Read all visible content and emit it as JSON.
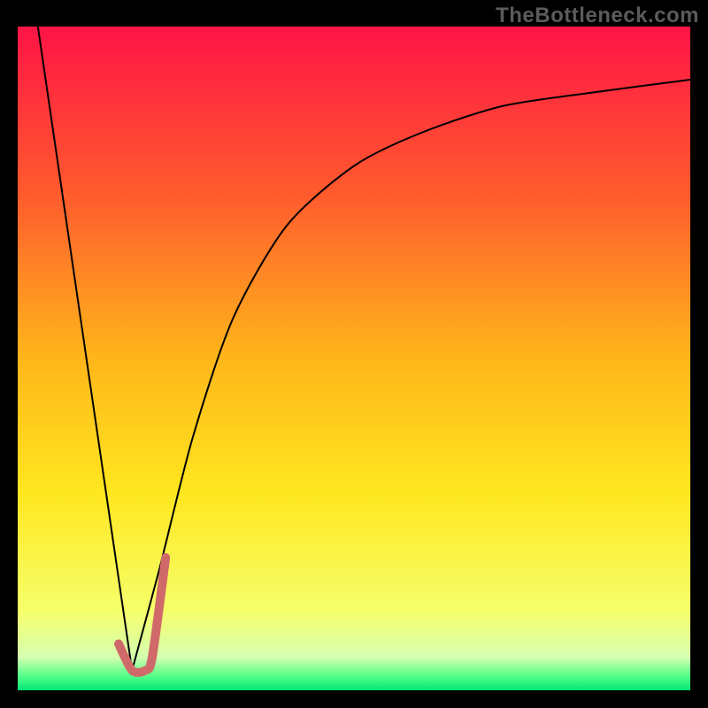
{
  "watermark": "TheBottleneck.com",
  "chart_data": {
    "type": "line",
    "title": "",
    "xlabel": "",
    "ylabel": "",
    "xlim": [
      0,
      100
    ],
    "ylim": [
      0,
      100
    ],
    "grid": false,
    "legend": false,
    "series": [
      {
        "name": "left-descent",
        "color": "#000000",
        "width": 2,
        "values": [
          {
            "x": 3,
            "y": 100
          },
          {
            "x": 17,
            "y": 3
          }
        ]
      },
      {
        "name": "right-curve",
        "color": "#000000",
        "width": 2,
        "values": [
          {
            "x": 17,
            "y": 3
          },
          {
            "x": 21,
            "y": 18
          },
          {
            "x": 26,
            "y": 38
          },
          {
            "x": 32,
            "y": 56
          },
          {
            "x": 40,
            "y": 70
          },
          {
            "x": 50,
            "y": 79
          },
          {
            "x": 60,
            "y": 84
          },
          {
            "x": 72,
            "y": 88
          },
          {
            "x": 85,
            "y": 90
          },
          {
            "x": 100,
            "y": 92
          }
        ]
      },
      {
        "name": "highlight-j",
        "color": "#d06a6a",
        "width": 10,
        "values": [
          {
            "x": 15,
            "y": 7
          },
          {
            "x": 17,
            "y": 3
          },
          {
            "x": 19,
            "y": 3
          },
          {
            "x": 20,
            "y": 5
          },
          {
            "x": 22,
            "y": 20
          }
        ]
      }
    ],
    "background_gradient": {
      "stops": [
        {
          "y": 100,
          "color": "#ff1446"
        },
        {
          "y": 75,
          "color": "#ff5a2d"
        },
        {
          "y": 50,
          "color": "#ffb61a"
        },
        {
          "y": 30,
          "color": "#ffe61f"
        },
        {
          "y": 12,
          "color": "#f6ff6a"
        },
        {
          "y": 5,
          "color": "#d6ffb0"
        },
        {
          "y": 2,
          "color": "#4fff88"
        },
        {
          "y": 0,
          "color": "#00e676"
        }
      ]
    }
  }
}
